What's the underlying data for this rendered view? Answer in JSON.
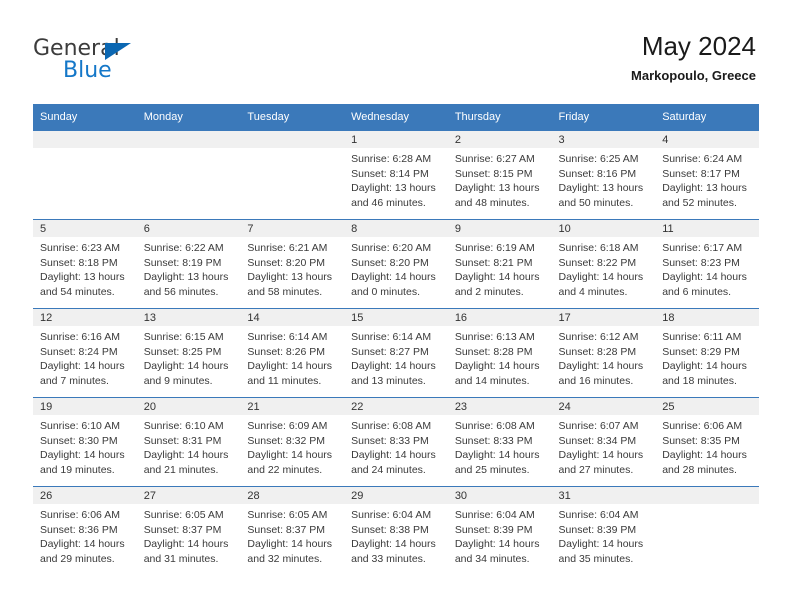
{
  "brand": {
    "name_top": "General",
    "name_bottom": "Blue",
    "triangle_color": "#0b67b2",
    "text_color": "#3c3c3c",
    "blue_color": "#1477c8"
  },
  "header": {
    "title": "May 2024",
    "subtitle": "Markopoulo, Greece",
    "header_bg": "#3b79ba",
    "header_text": "#ffffff",
    "daynum_band_bg": "#f0f0f0"
  },
  "calendar": {
    "weekday_headers": [
      "Sunday",
      "Monday",
      "Tuesday",
      "Wednesday",
      "Thursday",
      "Friday",
      "Saturday"
    ],
    "labels": {
      "sunrise_prefix": "Sunrise:",
      "sunset_prefix": "Sunset:",
      "daylight_prefix": "Daylight:"
    },
    "weeks": [
      [
        {
          "day": "",
          "empty": true
        },
        {
          "day": "",
          "empty": true
        },
        {
          "day": "",
          "empty": true
        },
        {
          "day": "1",
          "sunrise": "Sunrise: 6:28 AM",
          "sunset": "Sunset: 8:14 PM",
          "daylight": "Daylight: 13 hours and 46 minutes."
        },
        {
          "day": "2",
          "sunrise": "Sunrise: 6:27 AM",
          "sunset": "Sunset: 8:15 PM",
          "daylight": "Daylight: 13 hours and 48 minutes."
        },
        {
          "day": "3",
          "sunrise": "Sunrise: 6:25 AM",
          "sunset": "Sunset: 8:16 PM",
          "daylight": "Daylight: 13 hours and 50 minutes."
        },
        {
          "day": "4",
          "sunrise": "Sunrise: 6:24 AM",
          "sunset": "Sunset: 8:17 PM",
          "daylight": "Daylight: 13 hours and 52 minutes."
        }
      ],
      [
        {
          "day": "5",
          "sunrise": "Sunrise: 6:23 AM",
          "sunset": "Sunset: 8:18 PM",
          "daylight": "Daylight: 13 hours and 54 minutes."
        },
        {
          "day": "6",
          "sunrise": "Sunrise: 6:22 AM",
          "sunset": "Sunset: 8:19 PM",
          "daylight": "Daylight: 13 hours and 56 minutes."
        },
        {
          "day": "7",
          "sunrise": "Sunrise: 6:21 AM",
          "sunset": "Sunset: 8:20 PM",
          "daylight": "Daylight: 13 hours and 58 minutes."
        },
        {
          "day": "8",
          "sunrise": "Sunrise: 6:20 AM",
          "sunset": "Sunset: 8:20 PM",
          "daylight": "Daylight: 14 hours and 0 minutes."
        },
        {
          "day": "9",
          "sunrise": "Sunrise: 6:19 AM",
          "sunset": "Sunset: 8:21 PM",
          "daylight": "Daylight: 14 hours and 2 minutes."
        },
        {
          "day": "10",
          "sunrise": "Sunrise: 6:18 AM",
          "sunset": "Sunset: 8:22 PM",
          "daylight": "Daylight: 14 hours and 4 minutes."
        },
        {
          "day": "11",
          "sunrise": "Sunrise: 6:17 AM",
          "sunset": "Sunset: 8:23 PM",
          "daylight": "Daylight: 14 hours and 6 minutes."
        }
      ],
      [
        {
          "day": "12",
          "sunrise": "Sunrise: 6:16 AM",
          "sunset": "Sunset: 8:24 PM",
          "daylight": "Daylight: 14 hours and 7 minutes."
        },
        {
          "day": "13",
          "sunrise": "Sunrise: 6:15 AM",
          "sunset": "Sunset: 8:25 PM",
          "daylight": "Daylight: 14 hours and 9 minutes."
        },
        {
          "day": "14",
          "sunrise": "Sunrise: 6:14 AM",
          "sunset": "Sunset: 8:26 PM",
          "daylight": "Daylight: 14 hours and 11 minutes."
        },
        {
          "day": "15",
          "sunrise": "Sunrise: 6:14 AM",
          "sunset": "Sunset: 8:27 PM",
          "daylight": "Daylight: 14 hours and 13 minutes."
        },
        {
          "day": "16",
          "sunrise": "Sunrise: 6:13 AM",
          "sunset": "Sunset: 8:28 PM",
          "daylight": "Daylight: 14 hours and 14 minutes."
        },
        {
          "day": "17",
          "sunrise": "Sunrise: 6:12 AM",
          "sunset": "Sunset: 8:28 PM",
          "daylight": "Daylight: 14 hours and 16 minutes."
        },
        {
          "day": "18",
          "sunrise": "Sunrise: 6:11 AM",
          "sunset": "Sunset: 8:29 PM",
          "daylight": "Daylight: 14 hours and 18 minutes."
        }
      ],
      [
        {
          "day": "19",
          "sunrise": "Sunrise: 6:10 AM",
          "sunset": "Sunset: 8:30 PM",
          "daylight": "Daylight: 14 hours and 19 minutes."
        },
        {
          "day": "20",
          "sunrise": "Sunrise: 6:10 AM",
          "sunset": "Sunset: 8:31 PM",
          "daylight": "Daylight: 14 hours and 21 minutes."
        },
        {
          "day": "21",
          "sunrise": "Sunrise: 6:09 AM",
          "sunset": "Sunset: 8:32 PM",
          "daylight": "Daylight: 14 hours and 22 minutes."
        },
        {
          "day": "22",
          "sunrise": "Sunrise: 6:08 AM",
          "sunset": "Sunset: 8:33 PM",
          "daylight": "Daylight: 14 hours and 24 minutes."
        },
        {
          "day": "23",
          "sunrise": "Sunrise: 6:08 AM",
          "sunset": "Sunset: 8:33 PM",
          "daylight": "Daylight: 14 hours and 25 minutes."
        },
        {
          "day": "24",
          "sunrise": "Sunrise: 6:07 AM",
          "sunset": "Sunset: 8:34 PM",
          "daylight": "Daylight: 14 hours and 27 minutes."
        },
        {
          "day": "25",
          "sunrise": "Sunrise: 6:06 AM",
          "sunset": "Sunset: 8:35 PM",
          "daylight": "Daylight: 14 hours and 28 minutes."
        }
      ],
      [
        {
          "day": "26",
          "sunrise": "Sunrise: 6:06 AM",
          "sunset": "Sunset: 8:36 PM",
          "daylight": "Daylight: 14 hours and 29 minutes."
        },
        {
          "day": "27",
          "sunrise": "Sunrise: 6:05 AM",
          "sunset": "Sunset: 8:37 PM",
          "daylight": "Daylight: 14 hours and 31 minutes."
        },
        {
          "day": "28",
          "sunrise": "Sunrise: 6:05 AM",
          "sunset": "Sunset: 8:37 PM",
          "daylight": "Daylight: 14 hours and 32 minutes."
        },
        {
          "day": "29",
          "sunrise": "Sunrise: 6:04 AM",
          "sunset": "Sunset: 8:38 PM",
          "daylight": "Daylight: 14 hours and 33 minutes."
        },
        {
          "day": "30",
          "sunrise": "Sunrise: 6:04 AM",
          "sunset": "Sunset: 8:39 PM",
          "daylight": "Daylight: 14 hours and 34 minutes."
        },
        {
          "day": "31",
          "sunrise": "Sunrise: 6:04 AM",
          "sunset": "Sunset: 8:39 PM",
          "daylight": "Daylight: 14 hours and 35 minutes."
        },
        {
          "day": "",
          "empty": true
        }
      ]
    ]
  }
}
